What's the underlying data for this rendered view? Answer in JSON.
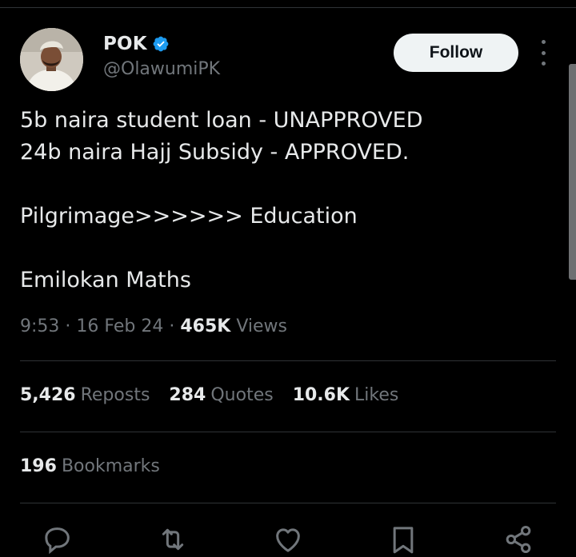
{
  "author": {
    "name": "POK",
    "handle": "@OlawumiPK",
    "verified": true,
    "verified_color": "#1d9bf0"
  },
  "follow_button": {
    "label": "Follow"
  },
  "tweet": {
    "lines": [
      "5b naira student loan - UNAPPROVED",
      "24b naira Hajj Subsidy - APPROVED.",
      "",
      "Pilgrimage>>>>>> Education",
      "",
      "Emilokan Maths"
    ]
  },
  "meta": {
    "time": "9:53",
    "date": "16 Feb 24",
    "views_count": "465K",
    "views_label": "Views"
  },
  "stats": {
    "reposts_count": "5,426",
    "reposts_label": "Reposts",
    "quotes_count": "284",
    "quotes_label": "Quotes",
    "likes_count": "10.6K",
    "likes_label": "Likes",
    "bookmarks_count": "196",
    "bookmarks_label": "Bookmarks"
  },
  "actions": [
    {
      "icon": "reply-icon"
    },
    {
      "icon": "repost-icon"
    },
    {
      "icon": "like-icon"
    },
    {
      "icon": "bookmark-icon"
    },
    {
      "icon": "share-icon"
    }
  ],
  "colors": {
    "background": "#000000",
    "text": "#e7e9ea",
    "muted": "#71767b",
    "divider": "#2f3336",
    "follow_bg": "#eff3f4"
  }
}
